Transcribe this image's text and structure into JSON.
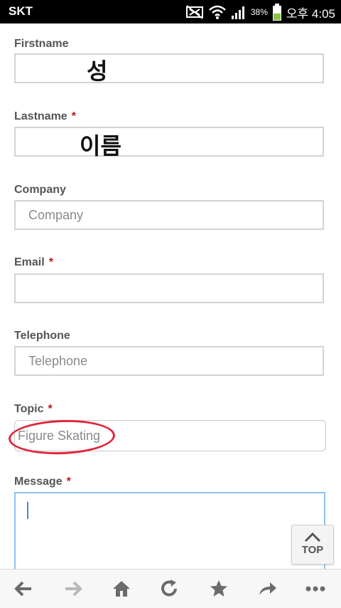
{
  "status_bar": {
    "carrier": "SKT",
    "battery_percent": "38%",
    "time": "오후 4:05",
    "icons": [
      "mute-icon",
      "wifi-icon",
      "signal-icon",
      "battery-icon"
    ]
  },
  "form": {
    "required_mark": "*",
    "firstname": {
      "label": "Firstname",
      "value": "성"
    },
    "lastname": {
      "label": "Lastname",
      "value": "이름"
    },
    "company": {
      "label": "Company",
      "placeholder": "Company"
    },
    "email": {
      "label": "Email"
    },
    "telephone": {
      "label": "Telephone",
      "placeholder": "Telephone"
    },
    "topic": {
      "label": "Topic",
      "value": "Figure Skating"
    },
    "message": {
      "label": "Message"
    }
  },
  "top_button": {
    "label": "TOP"
  },
  "toolbar": {
    "icons": [
      "back-icon",
      "forward-icon",
      "home-icon",
      "reload-icon",
      "bookmark-icon",
      "share-icon",
      "more-icon"
    ]
  },
  "colors": {
    "required": "#c0141a",
    "annotation": "#e0263a",
    "focus": "#8cc3ef"
  }
}
